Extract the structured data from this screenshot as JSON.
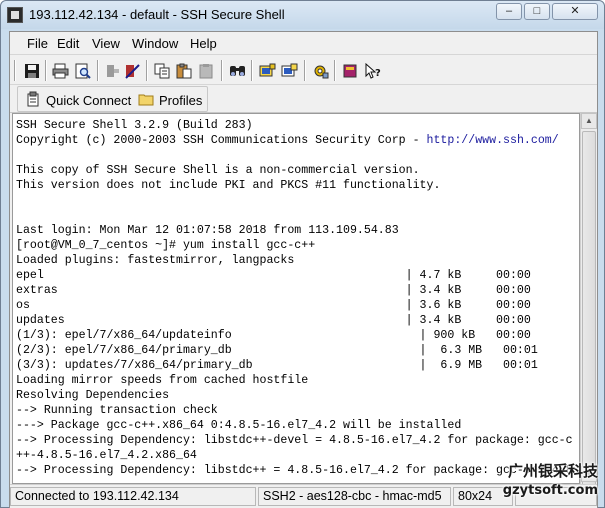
{
  "window": {
    "title": "193.112.42.134 - default - SSH Secure Shell",
    "minimize_glyph": "–",
    "maximize_glyph": "□",
    "close_glyph": "✕"
  },
  "menu": [
    "File",
    "Edit",
    "View",
    "Window",
    "Help"
  ],
  "toolbar": {
    "icons": [
      "save-icon",
      "print-icon",
      "print-preview-icon",
      "disconnect-icon",
      "settings-quick-icon",
      "copy-icon",
      "paste-icon",
      "paste-disabled-icon",
      "find-icon",
      "new-file-transfer-icon",
      "new-terminal-icon",
      "options-icon",
      "help-book-icon",
      "context-help-icon"
    ]
  },
  "linkbar": {
    "quick_connect": "Quick Connect",
    "profiles": "Profiles"
  },
  "terminal": {
    "url": "http://www.ssh.com/",
    "lines": [
      "SSH Secure Shell 3.2.9 (Build 283)",
      "Copyright (c) 2000-2003 SSH Communications Security Corp - ",
      "",
      "This copy of SSH Secure Shell is a non-commercial version.",
      "This version does not include PKI and PKCS #11 functionality.",
      "",
      "",
      "Last login: Mon Mar 12 01:07:58 2018 from 113.109.54.83",
      "[root@VM_0_7_centos ~]# yum install gcc-c++",
      "Loaded plugins: fastestmirror, langpacks",
      "epel                                                    | 4.7 kB     00:00",
      "extras                                                  | 3.4 kB     00:00",
      "os                                                      | 3.6 kB     00:00",
      "updates                                                 | 3.4 kB     00:00",
      "(1/3): epel/7/x86_64/updateinfo                           | 900 kB   00:00",
      "(2/3): epel/7/x86_64/primary_db                           |  6.3 MB   00:01",
      "(3/3): updates/7/x86_64/primary_db                        |  6.9 MB   00:01",
      "Loading mirror speeds from cached hostfile",
      "Resolving Dependencies",
      "--> Running transaction check",
      "---> Package gcc-c++.x86_64 0:4.8.5-16.el7_4.2 will be installed",
      "--> Processing Dependency: libstdc++-devel = 4.8.5-16.el7_4.2 for package: gcc-c",
      "++-4.8.5-16.el7_4.2.x86_64",
      "--> Processing Dependency: libstdc++ = 4.8.5-16.el7_4.2 for package: gcc-c++-4.8"
    ]
  },
  "status": {
    "connection": "Connected to 193.112.42.134",
    "cipher": "SSH2 - aes128-cbc - hmac-md5",
    "size": "80x24"
  },
  "watermark": {
    "line1": "广州银采科技",
    "line2": "gzytsoft.com"
  }
}
